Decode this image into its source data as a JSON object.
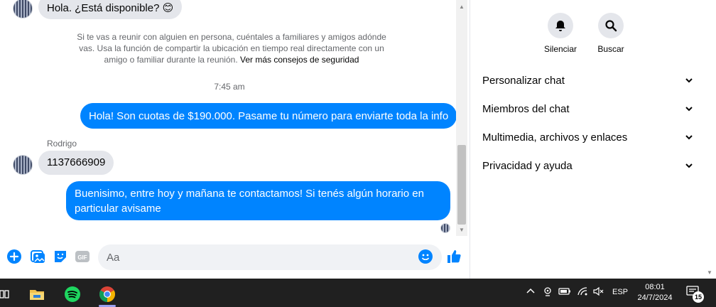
{
  "chat": {
    "first_incoming": "Hola. ¿Está disponible?",
    "first_incoming_emoji": "😊",
    "safety_notice": "Si te vas a reunir con alguien en persona, cuéntales a familiares y amigos adónde vas. Usa la función de compartir la ubicación en tiempo real directamente con un amigo o familiar durante la reunión.",
    "safety_link": "Ver más consejos de seguridad",
    "timestamp": "7:45 am",
    "outgoing_1": "Hola! Son cuotas de $190.000. Pasame tu número para enviarte toda la info",
    "sender_name": "Rodrigo",
    "incoming_phone": "1137666909",
    "outgoing_2": "Buenisimo, entre hoy y mañana te contactamos! Si tenés algún horario en particular avisame"
  },
  "composer": {
    "placeholder": "Aa",
    "gif_label": "GIF"
  },
  "side": {
    "actions": [
      {
        "label": "Silenciar",
        "icon": "bell-icon"
      },
      {
        "label": "Buscar",
        "icon": "search-icon"
      }
    ],
    "sections": [
      {
        "label": "Personalizar chat"
      },
      {
        "label": "Miembros del chat"
      },
      {
        "label": "Multimedia, archivos y enlaces"
      },
      {
        "label": "Privacidad y ayuda"
      }
    ]
  },
  "taskbar": {
    "language": "ESP",
    "time": "08:01",
    "date": "24/7/2024",
    "notification_count": "15"
  },
  "colors": {
    "accent": "#0084ff",
    "bubble_in": "#e4e6eb",
    "taskbar": "#202020"
  }
}
